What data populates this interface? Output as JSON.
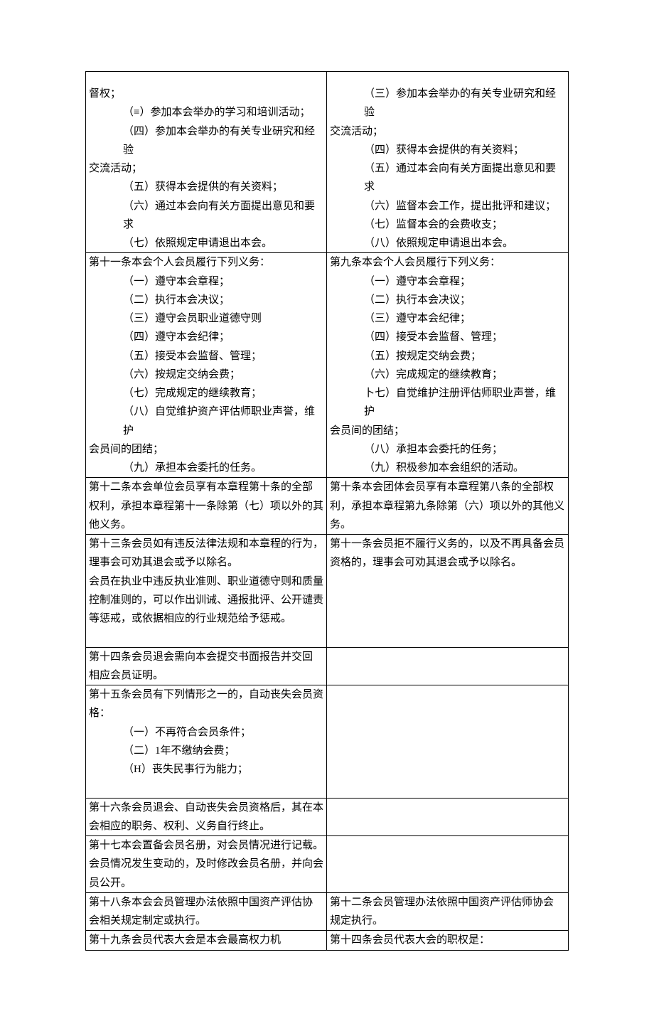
{
  "rows": [
    {
      "left": {
        "lines": [
          {
            "t": "督权；",
            "cls": "top-pad"
          },
          {
            "t": "（≡）参加本会举办的学习和培训活动；",
            "cls": "indent"
          },
          {
            "t": "（四）参加本会举办的有关专业研究和经验",
            "cls": "indent"
          },
          {
            "t": "交流活动；"
          },
          {
            "t": "（五）获得本会提供的有关资料；",
            "cls": "indent"
          },
          {
            "t": "（六）通过本会向有关方面提出意见和要求",
            "cls": "indent"
          },
          {
            "t": "（七）依照规定申请退出本会。",
            "cls": "indent"
          }
        ]
      },
      "right": {
        "lines": [
          {
            "t": "（三）参加本会举办的有关专业研究和经验",
            "cls": "indent top-pad"
          },
          {
            "t": "交流活动；"
          },
          {
            "t": "（四）获得本会提供的有关资料；",
            "cls": "indent"
          },
          {
            "t": "（五）通过本会向有关方面提出意见和要求",
            "cls": "indent"
          },
          {
            "t": "（六）监督本会工作，提出批评和建议；",
            "cls": "indent"
          },
          {
            "t": "（七）监督本会的会费收支；",
            "cls": "indent"
          },
          {
            "t": "（八）依照规定申请退出本会。",
            "cls": "indent"
          }
        ]
      }
    },
    {
      "left": {
        "lines": [
          {
            "t": "第十一条本会个人会员履行下列义务："
          },
          {
            "t": "（一）遵守本会章程；",
            "cls": "indent"
          },
          {
            "t": "（二）执行本会决议；",
            "cls": "indent"
          },
          {
            "t": "（三）遵守会员职业道德守则",
            "cls": "indent"
          },
          {
            "t": "（四）遵守本会纪律；",
            "cls": "indent"
          },
          {
            "t": "（五）接受本会监督、管理；",
            "cls": "indent"
          },
          {
            "t": "（六）按规定交纳会费；",
            "cls": "indent"
          },
          {
            "t": "（七）完成规定的继续教育；",
            "cls": "indent"
          },
          {
            "t": "（八）自觉维护资产评估师职业声誉，维护",
            "cls": "indent"
          },
          {
            "t": "会员间的团结；"
          },
          {
            "t": "（九）承担本会委托的任务。",
            "cls": "indent"
          }
        ]
      },
      "right": {
        "lines": [
          {
            "t": "第九条本会个人会员履行下列义务："
          },
          {
            "t": "（一）遵守本会章程；",
            "cls": "indent"
          },
          {
            "t": "（二）执行本会决议；",
            "cls": "indent"
          },
          {
            "t": "（三）遵守本会纪律；",
            "cls": "indent"
          },
          {
            "t": "（四）接受本会监督、管理；",
            "cls": "indent"
          },
          {
            "t": "（五）按规定交纳会费；",
            "cls": "indent"
          },
          {
            "t": "（六）完成规定的继续教育；",
            "cls": "indent"
          },
          {
            "t": "卜七）自觉维护注册评估师职业声誉，维护",
            "cls": "indent"
          },
          {
            "t": "会员间的团结；"
          },
          {
            "t": "（八）承担本会委托的任务；",
            "cls": "indent"
          },
          {
            "t": "（九）积极参加本会组织的活动。",
            "cls": "indent"
          }
        ]
      }
    },
    {
      "left": {
        "lines": [
          {
            "t": "第十二条本会单位会员享有本章程第十条的全部"
          },
          {
            "t": "权利，承担本章程第十一条除第（七）项以外的其"
          },
          {
            "t": "他义务。"
          }
        ]
      },
      "right": {
        "lines": [
          {
            "t": "第十条本会团体会员享有本章程第八条的全部权"
          },
          {
            "t": "利，承担本章程第九条除第（六）项以外的其他义"
          },
          {
            "t": "务。"
          }
        ]
      }
    },
    {
      "left": {
        "lines": [
          {
            "t": "第十三条会员如有违反法律法规和本章程的行为，"
          },
          {
            "t": "理事会可劝其退会或予以除名。"
          },
          {
            "t": "会员在执业中违反执业准则、职业道德守则和质量"
          },
          {
            "t": "控制准则的，可以作出训诫、通报批评、公开谴责"
          },
          {
            "t": "等惩戒，或依据相应的行业规范给予惩戒。"
          },
          {
            "t": " "
          }
        ]
      },
      "right": {
        "lines": [
          {
            "t": "第十一条会员拒不履行义务的，以及不再具备会员"
          },
          {
            "t": "资格的，理事会可劝其退会或予以除名。"
          }
        ]
      }
    },
    {
      "left": {
        "lines": [
          {
            "t": "第十四条会员退会需向本会提交书面报告并交回"
          },
          {
            "t": "相应会员证明。"
          }
        ]
      },
      "right": {
        "lines": []
      }
    },
    {
      "left": {
        "lines": [
          {
            "t": "第十五条会员有下列情形之一的，自动丧失会员资"
          },
          {
            "t": "格："
          },
          {
            "t": "（一）不再符合会员条件；",
            "cls": "indent"
          },
          {
            "t": "（二）1年不缴纳会费；",
            "cls": "indent"
          },
          {
            "t": "（H）丧失民事行为能力；",
            "cls": "indent"
          },
          {
            "t": " ",
            "cls": "indent"
          }
        ]
      },
      "right": {
        "lines": []
      }
    },
    {
      "left": {
        "lines": [
          {
            "t": "第十六条会员退会、自动丧失会员资格后，其在本"
          },
          {
            "t": "会相应的职务、权利、义务自行终止。"
          }
        ]
      },
      "right": {
        "lines": []
      }
    },
    {
      "left": {
        "lines": [
          {
            "t": "第十七本会置备会员名册，对会员情况进行记载。"
          },
          {
            "t": "会员情况发生变动的，及时修改会员名册，并向会"
          },
          {
            "t": "员公开。"
          }
        ]
      },
      "right": {
        "lines": []
      }
    },
    {
      "left": {
        "lines": [
          {
            "t": "第十八条本会会员管理办法依照中国资产评估协"
          },
          {
            "t": "会相关规定制定或执行。"
          }
        ]
      },
      "right": {
        "lines": [
          {
            "t": "第十二条会员管理办法依照中国资产评估师协会"
          },
          {
            "t": "规定执行。"
          }
        ]
      }
    },
    {
      "left": {
        "lines": [
          {
            "t": "第十九条会员代表大会是本会最高权力机"
          }
        ]
      },
      "right": {
        "lines": [
          {
            "t": "第十四条会员代表大会的职权是："
          }
        ]
      }
    }
  ]
}
